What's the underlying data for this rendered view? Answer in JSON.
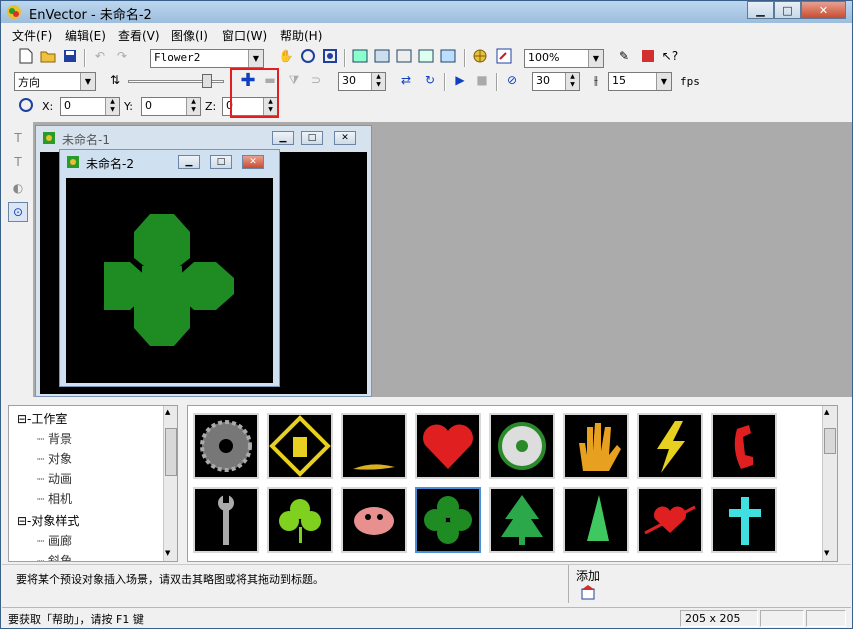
{
  "app": {
    "title": "EnVector - 未命名-2"
  },
  "menu": {
    "items": [
      "文件(F)",
      "编辑(E)",
      "查看(V)",
      "图像(I)",
      "窗口(W)",
      "帮助(H)"
    ]
  },
  "toolbar1": {
    "object_combo": "Flower2",
    "zoom_combo": "100%"
  },
  "toolbar2": {
    "direction_combo": "方向",
    "angle_value": "30",
    "frames_value": "30",
    "fps_combo": "15",
    "fps_label": "fps"
  },
  "toolbar3": {
    "x_label": "X:",
    "x_value": "0",
    "y_label": "Y:",
    "y_value": "0",
    "z_label": "Z:",
    "z_value": "0"
  },
  "windows": {
    "child1_title": "未命名-1",
    "child2_title": "未命名-2"
  },
  "tree": {
    "nodes": [
      "工作室",
      "背景",
      "对象",
      "动画",
      "相机",
      "对象样式",
      "画廊",
      "斜角"
    ]
  },
  "gallery": {
    "rows": [
      [
        "gear",
        "sign",
        "lizard",
        "heart",
        "film-reel",
        "hand",
        "lightning",
        "phone"
      ],
      [
        "wrench",
        "clover",
        "crab",
        "clover-selected",
        "tree",
        "sail",
        "heart-arrow",
        "cross"
      ]
    ]
  },
  "message": {
    "text": "要将某个预设对象插入场景，请双击其略图或将其拖动到标题。",
    "add_label": "添加"
  },
  "status": {
    "help_text": "要获取「帮助」，请按 F1 键",
    "size": "205 x 205"
  },
  "colors": {
    "clover": "#1e8c22",
    "highlight_box": "#e02020"
  }
}
